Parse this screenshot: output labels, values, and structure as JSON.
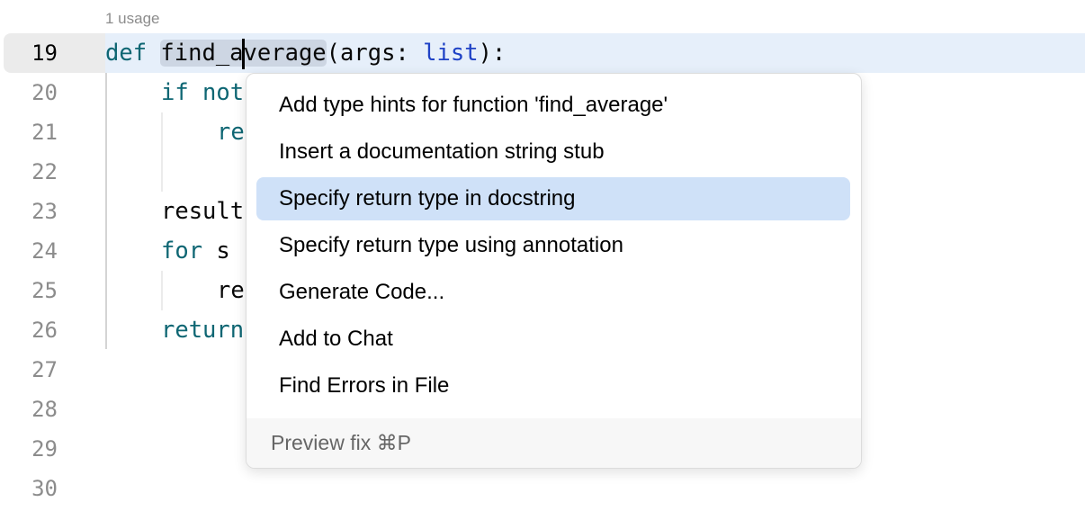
{
  "editor": {
    "usage_hint": "1 usage",
    "line_numbers": [
      "19",
      "20",
      "21",
      "22",
      "23",
      "24",
      "25",
      "26",
      "27",
      "28",
      "29",
      "30"
    ],
    "lines": {
      "l19": {
        "kw": "def",
        "name_a": "find_a",
        "name_b": "verage",
        "rest": "(args: ",
        "type": "list",
        "end": "):"
      },
      "l20": "if not",
      "l21": "re",
      "l23": "result",
      "l24_kw": "for",
      "l24_rest": " s",
      "l25": "re",
      "l26": "return"
    }
  },
  "popup": {
    "items": [
      "Add type hints for function 'find_average'",
      "Insert a documentation string stub",
      "Specify return type in docstring",
      "Specify return type using annotation",
      "Generate Code...",
      "Add to Chat",
      "Find Errors in File"
    ],
    "selected_index": 2,
    "footer": "Preview fix ⌘P"
  }
}
